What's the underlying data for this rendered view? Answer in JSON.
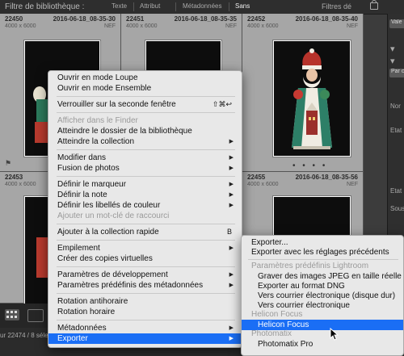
{
  "filter_bar": {
    "title": "Filtre de bibliothèque :",
    "buttons": [
      "Texte",
      "Attribut",
      "Métadonnées",
      "Sans"
    ],
    "right_label": "Filtres dé"
  },
  "grid": {
    "cells": [
      {
        "number": "22450",
        "date": "2016-06-18_08-35-30",
        "dims": "4000 x 6000",
        "ext": "NEF"
      },
      {
        "number": "22451",
        "date": "2016-06-18_08-35-35",
        "dims": "4000 x 6000",
        "ext": "NEF"
      },
      {
        "number": "22452",
        "date": "2016-06-18_08-35-40",
        "dims": "4000 x 6000",
        "ext": "NEF"
      },
      {
        "number": "22453",
        "date": "",
        "dims": "4000 x 6000",
        "ext": ""
      },
      {
        "number": "",
        "date": "",
        "dims": "",
        "ext": ""
      },
      {
        "number": "22455",
        "date": "2016-06-18_08-35-56",
        "dims": "4000 x 6000",
        "ext": "NEF"
      }
    ]
  },
  "right_panel": {
    "items": [
      "Vale",
      "Par c",
      "Nor",
      "Etat",
      "Etat",
      "Sous-"
    ]
  },
  "status": {
    "text": "ur 22474 / 8 séle"
  },
  "context_menu": {
    "items": [
      {
        "label": "Ouvrir en mode Loupe",
        "shortcut": "",
        "submenu": false,
        "disabled": false
      },
      {
        "label": "Ouvrir en mode Ensemble",
        "shortcut": "",
        "submenu": false,
        "disabled": false
      },
      {
        "sep": true
      },
      {
        "label": "Verrouiller sur la seconde fenêtre",
        "shortcut": "⇧⌘↩",
        "submenu": false,
        "disabled": false
      },
      {
        "sep": true
      },
      {
        "label": "Afficher dans le Finder",
        "shortcut": "",
        "submenu": false,
        "disabled": true
      },
      {
        "label": "Atteindre le dossier de la bibliothèque",
        "shortcut": "",
        "submenu": false,
        "disabled": false
      },
      {
        "label": "Atteindre la collection",
        "shortcut": "",
        "submenu": true,
        "disabled": false
      },
      {
        "sep": true
      },
      {
        "label": "Modifier dans",
        "shortcut": "",
        "submenu": true,
        "disabled": false
      },
      {
        "label": "Fusion de photos",
        "shortcut": "",
        "submenu": true,
        "disabled": false
      },
      {
        "sep": true
      },
      {
        "label": "Définir le marqueur",
        "shortcut": "",
        "submenu": true,
        "disabled": false
      },
      {
        "label": "Définir la note",
        "shortcut": "",
        "submenu": true,
        "disabled": false
      },
      {
        "label": "Définir les libellés de couleur",
        "shortcut": "",
        "submenu": true,
        "disabled": false
      },
      {
        "label": "Ajouter un mot-clé de raccourci",
        "shortcut": "",
        "submenu": false,
        "disabled": true
      },
      {
        "sep": true
      },
      {
        "label": "Ajouter à la collection rapide",
        "shortcut": "B",
        "submenu": false,
        "disabled": false
      },
      {
        "sep": true
      },
      {
        "label": "Empilement",
        "shortcut": "",
        "submenu": true,
        "disabled": false
      },
      {
        "label": "Créer des copies virtuelles",
        "shortcut": "",
        "submenu": false,
        "disabled": false
      },
      {
        "sep": true
      },
      {
        "label": "Paramètres de développement",
        "shortcut": "",
        "submenu": true,
        "disabled": false
      },
      {
        "label": "Paramètres prédéfinis des métadonnées",
        "shortcut": "",
        "submenu": true,
        "disabled": false
      },
      {
        "sep": true
      },
      {
        "label": "Rotation antihoraire",
        "shortcut": "",
        "submenu": false,
        "disabled": false
      },
      {
        "label": "Rotation horaire",
        "shortcut": "",
        "submenu": false,
        "disabled": false
      },
      {
        "sep": true
      },
      {
        "label": "Métadonnées",
        "shortcut": "",
        "submenu": true,
        "disabled": false
      },
      {
        "label": "Exporter",
        "shortcut": "",
        "submenu": true,
        "disabled": false,
        "highlighted": true
      }
    ]
  },
  "submenu": {
    "items": [
      {
        "type": "item",
        "label": "Exporter..."
      },
      {
        "type": "item",
        "label": "Exporter avec les réglages précédents"
      },
      {
        "type": "sep"
      },
      {
        "type": "header",
        "label": "Paramètres prédéfinis Lightroom"
      },
      {
        "type": "item",
        "label": "Graver des images JPEG en taille réelle",
        "indent": true
      },
      {
        "type": "item",
        "label": "Exporter au format DNG",
        "indent": true
      },
      {
        "type": "item",
        "label": "Vers courrier électronique (disque dur)",
        "indent": true
      },
      {
        "type": "item",
        "label": "Vers courrier électronique",
        "indent": true
      },
      {
        "type": "header",
        "label": "Helicon Focus"
      },
      {
        "type": "item",
        "label": "Helicon Focus",
        "indent": true,
        "highlighted": true
      },
      {
        "type": "header",
        "label": "Photomatix"
      },
      {
        "type": "item",
        "label": "Photomatix Pro",
        "indent": true
      }
    ]
  },
  "colors": {
    "highlight": "#1a6ef5",
    "menu_bg": "#e8e8e8",
    "cell_bg": "#a6a6a6"
  }
}
